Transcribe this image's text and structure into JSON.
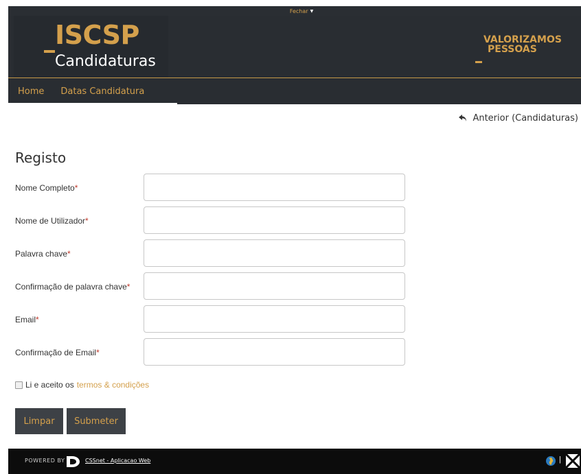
{
  "top_strip": {
    "close_label": "Fechar"
  },
  "header": {
    "logo_title": "ISCSP",
    "logo_subtitle": "Candidaturas",
    "slogan_line1": "VALORIZAMOS",
    "slogan_line2": "PESSOAS"
  },
  "nav": {
    "items": [
      {
        "label": "Home"
      },
      {
        "label": "Datas Candidatura"
      }
    ]
  },
  "back_link": {
    "label": "Anterior (Candidaturas)"
  },
  "form": {
    "title": "Registo",
    "required_mark": "*",
    "fields": [
      {
        "label": "Nome Completo",
        "value": ""
      },
      {
        "label": "Nome de Utilizador",
        "value": ""
      },
      {
        "label": "Palavra chave",
        "value": ""
      },
      {
        "label": "Confirmação de palavra chave",
        "value": ""
      },
      {
        "label": "Email",
        "value": ""
      },
      {
        "label": "Confirmação de Email",
        "value": ""
      }
    ],
    "terms_text": "Li e aceito os",
    "terms_link": "termos & condições",
    "clear_button": "Limpar",
    "submit_button": "Submeter"
  },
  "footer": {
    "powered_by": "POWERED BY",
    "app_link": "CSSnet - Aplicacao Web"
  },
  "colors": {
    "accent": "#d4a04c",
    "header_bg": "#292d32",
    "button_bg": "#3d4146",
    "footer_bg": "#0c0c0c"
  },
  "icons": [
    "caret-down-icon",
    "back-arrow-icon",
    "d-logo-icon",
    "globe-icon",
    "flag-icon"
  ]
}
